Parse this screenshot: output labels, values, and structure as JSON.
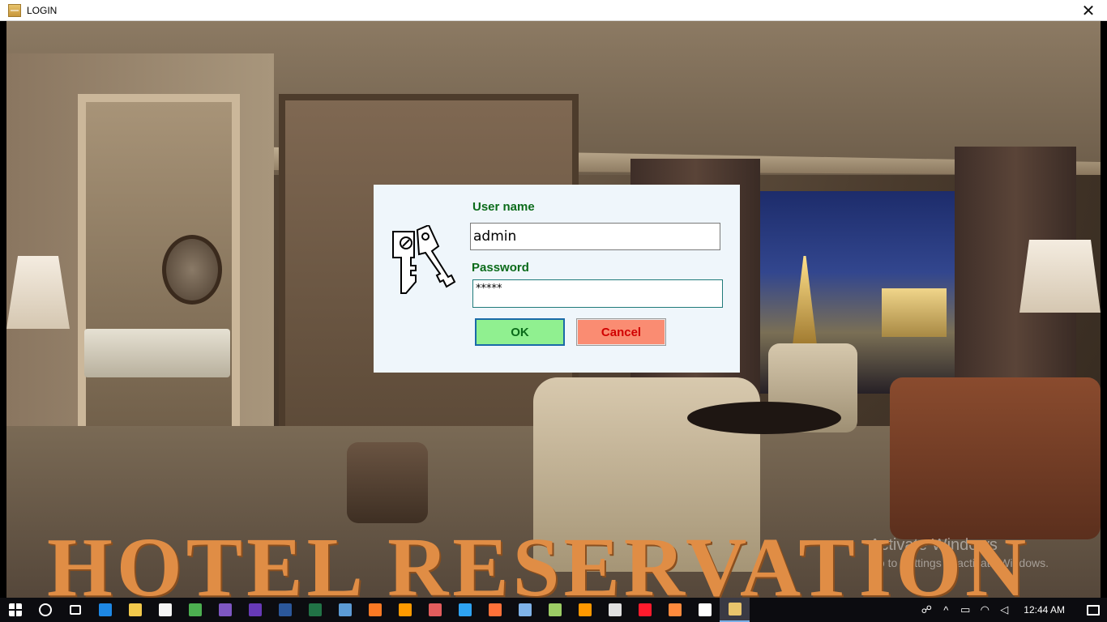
{
  "window": {
    "title": "LOGIN",
    "close_glyph": "✕"
  },
  "login": {
    "username_label": "User name",
    "username_value": "admin",
    "password_label": "Password",
    "password_value": "*****",
    "ok_label": "OK",
    "cancel_label": "Cancel"
  },
  "banner": {
    "text": "HOTEL RESERVATION"
  },
  "watermark": {
    "title": "Activate Windows",
    "subtitle": "Go to Settings to activate Windows."
  },
  "taskbar": {
    "icons": [
      {
        "name": "start-icon",
        "color": "#ffffff"
      },
      {
        "name": "cortana-icon",
        "color": "#ffffff"
      },
      {
        "name": "task-view-icon",
        "color": "#ffffff"
      },
      {
        "name": "edge-icon",
        "color": "#1e88e5"
      },
      {
        "name": "file-explorer-icon",
        "color": "#f2c94c"
      },
      {
        "name": "store-icon",
        "color": "#f5f5f5"
      },
      {
        "name": "chrome-icon",
        "color": "#4caf50"
      },
      {
        "name": "visual-studio-icon",
        "color": "#7e57c2"
      },
      {
        "name": "visual-studio-2-icon",
        "color": "#673ab7"
      },
      {
        "name": "word-icon",
        "color": "#2b579a"
      },
      {
        "name": "excel-style-icon",
        "color": "#217346"
      },
      {
        "name": "app-icon-a",
        "color": "#5c9bd5"
      },
      {
        "name": "xampp-icon",
        "color": "#fb7a24"
      },
      {
        "name": "illustrator-icon",
        "color": "#ff9a00"
      },
      {
        "name": "app-icon-b",
        "color": "#e35d5d"
      },
      {
        "name": "app-icon-c",
        "color": "#2ea3f2"
      },
      {
        "name": "firefox-icon",
        "color": "#ff7139"
      },
      {
        "name": "notepad-icon",
        "color": "#7fb3e8"
      },
      {
        "name": "app-icon-d",
        "color": "#9ccc65"
      },
      {
        "name": "sublime-icon",
        "color": "#ff9800"
      },
      {
        "name": "mail-icon",
        "color": "#e0e0e0"
      },
      {
        "name": "opera-icon",
        "color": "#ff1b2d"
      },
      {
        "name": "app-icon-e",
        "color": "#ff8a3d"
      },
      {
        "name": "app-icon-f",
        "color": "#ffffff"
      },
      {
        "name": "hotel-app-icon",
        "color": "#e8c46c"
      }
    ],
    "tray": {
      "people_glyph": "☍",
      "chevron_glyph": "^",
      "battery_glyph": "▭",
      "wifi_glyph": "◠",
      "volume_glyph": "◁",
      "time": "12:44 AM"
    }
  }
}
